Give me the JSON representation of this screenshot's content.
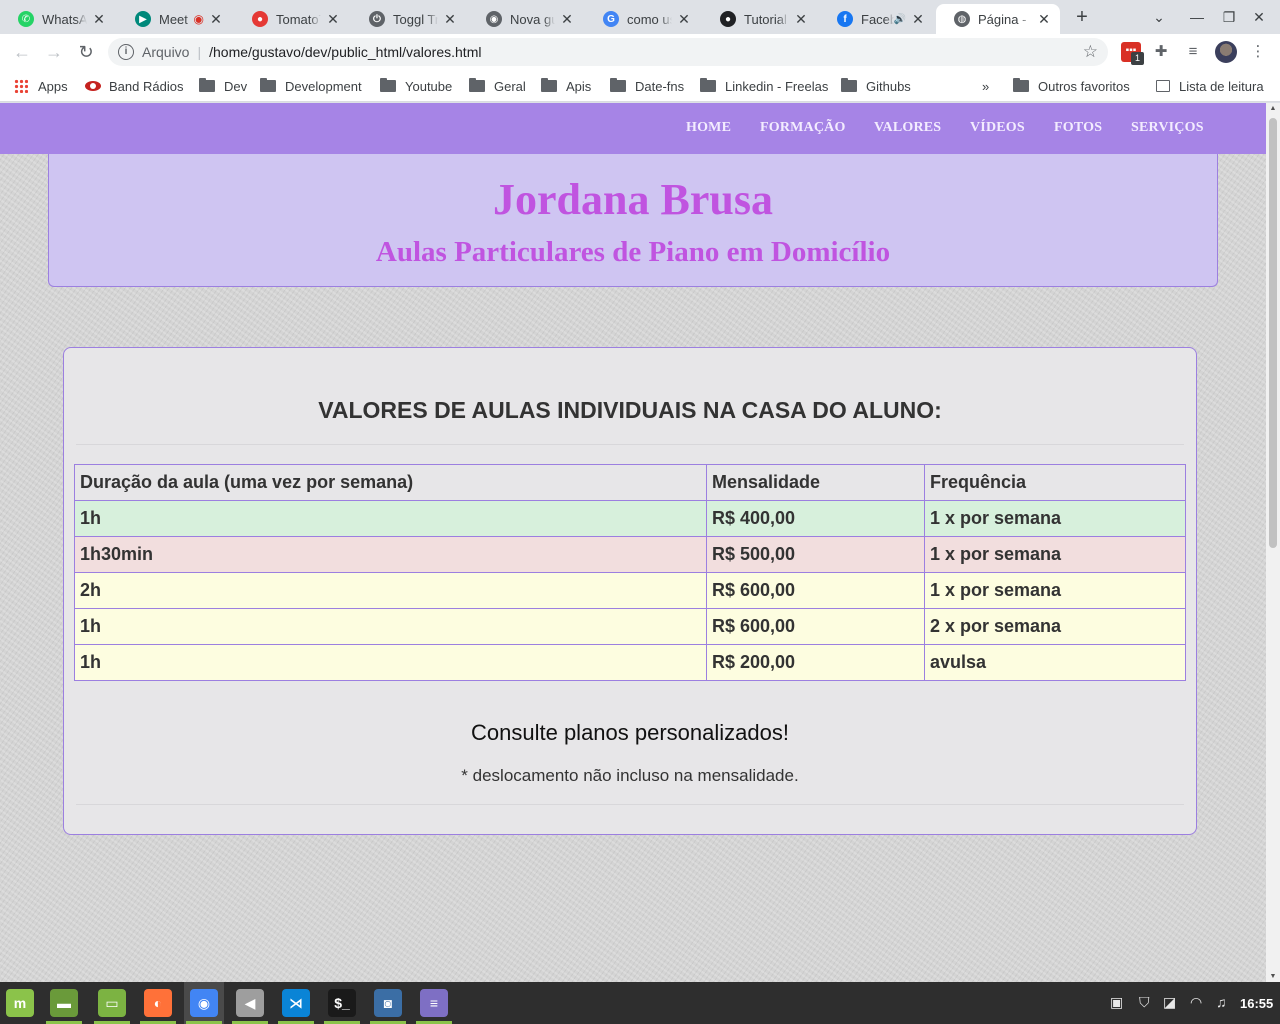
{
  "browser": {
    "tabs": [
      {
        "title": "WhatsApp",
        "icon": "whatsapp-icon",
        "color": "#25d366",
        "glyph": "✆"
      },
      {
        "title": "Meet",
        "icon": "google-meet-icon",
        "color": "#00897b",
        "glyph": "▶",
        "recording": true
      },
      {
        "title": "TomatoTimer",
        "icon": "tomato-icon",
        "color": "#e53935",
        "glyph": "●"
      },
      {
        "title": "Toggl Track",
        "icon": "toggl-icon",
        "color": "#5f6368",
        "glyph": "⏻"
      },
      {
        "title": "Nova guia",
        "icon": "chrome-icon",
        "color": "#5f6368",
        "glyph": "◉"
      },
      {
        "title": "como usar",
        "icon": "google-icon",
        "color": "#4285f4",
        "glyph": "G"
      },
      {
        "title": "Tutorial",
        "icon": "github-icon",
        "color": "#202124",
        "glyph": "●"
      },
      {
        "title": "Facebook",
        "icon": "facebook-icon",
        "color": "#1877f2",
        "glyph": "f",
        "audio": true
      },
      {
        "title": "Página -",
        "icon": "globe-icon",
        "color": "#5f6368",
        "glyph": "◍",
        "active": true
      }
    ],
    "new_tab": "+",
    "address": {
      "scheme_label": "Arquivo",
      "url": "/home/gustavo/dev/public_html/valores.html"
    },
    "extension_badge": "1",
    "bookmarks": [
      {
        "label": "Apps",
        "icon": "apps-grid-icon"
      },
      {
        "label": "Band Rádios",
        "icon": "band-radios-icon"
      },
      {
        "label": "Dev",
        "icon": "folder-icon"
      },
      {
        "label": "Development",
        "icon": "folder-icon"
      },
      {
        "label": "Youtube",
        "icon": "folder-icon"
      },
      {
        "label": "Geral",
        "icon": "folder-icon"
      },
      {
        "label": "Apis",
        "icon": "folder-icon"
      },
      {
        "label": "Date-fns",
        "icon": "folder-icon"
      },
      {
        "label": "Linkedin - Freelas",
        "icon": "folder-icon"
      },
      {
        "label": "Githubs",
        "icon": "folder-icon"
      }
    ],
    "bookmarks_overflow": "»",
    "other_bookmarks": "Outros favoritos",
    "reading_list": "Lista de leitura"
  },
  "site": {
    "nav": [
      "HOME",
      "FORMAÇÃO",
      "VALORES",
      "VÍDEOS",
      "FOTOS",
      "SERVIÇOS"
    ],
    "title": "Jordana Brusa",
    "subtitle": "Aulas Particulares de Piano em Domicílio",
    "colors": {
      "nav_bg": "#a684e6",
      "title": "#c054e0",
      "header_bg": "#cfc5f2",
      "border": "#9c7fe0"
    }
  },
  "pricing": {
    "heading": "VALORES DE AULAS INDIVIDUAIS NA CASA DO ALUNO:",
    "columns": [
      "Duração da aula (uma vez por semana)",
      "Mensalidade",
      "Frequência"
    ],
    "rows": [
      {
        "duration": "1h",
        "price": "R$ 400,00",
        "frequency": "1 x por semana",
        "status": "success"
      },
      {
        "duration": "1h30min",
        "price": "R$ 500,00",
        "frequency": "1 x por semana",
        "status": "danger"
      },
      {
        "duration": "2h",
        "price": "R$ 600,00",
        "frequency": "1 x por semana",
        "status": "warning"
      },
      {
        "duration": "1h",
        "price": "R$ 600,00",
        "frequency": "2 x por semana",
        "status": "warning"
      },
      {
        "duration": "1h",
        "price": "R$ 200,00",
        "frequency": "avulsa",
        "status": "warning"
      }
    ],
    "plans_text": "Consulte planos personalizados!",
    "note": "* deslocamento não incluso na mensalidade."
  },
  "taskbar": {
    "apps": [
      {
        "name": "mint-menu-icon",
        "color": "#8bc34a",
        "glyph": "m"
      },
      {
        "name": "show-desktop-icon",
        "color": "#6a9a3a",
        "glyph": "▬"
      },
      {
        "name": "files-icon",
        "color": "#7cb342",
        "glyph": "▭"
      },
      {
        "name": "firefox-icon",
        "color": "#ff7139",
        "glyph": "◐"
      },
      {
        "name": "chrome-icon",
        "color": "#4285f4",
        "glyph": "◉"
      },
      {
        "name": "audio-app-icon",
        "color": "#9e9e9e",
        "glyph": "◀"
      },
      {
        "name": "vscode-icon",
        "color": "#0a84d6",
        "glyph": "⋊"
      },
      {
        "name": "terminal-icon",
        "color": "#1a1a1a",
        "glyph": "$_"
      },
      {
        "name": "screenshot-icon",
        "color": "#3b6ea5",
        "glyph": "◙"
      },
      {
        "name": "text-editor-icon",
        "color": "#7e6fc4",
        "glyph": "≡"
      }
    ],
    "clock": "16:55"
  }
}
